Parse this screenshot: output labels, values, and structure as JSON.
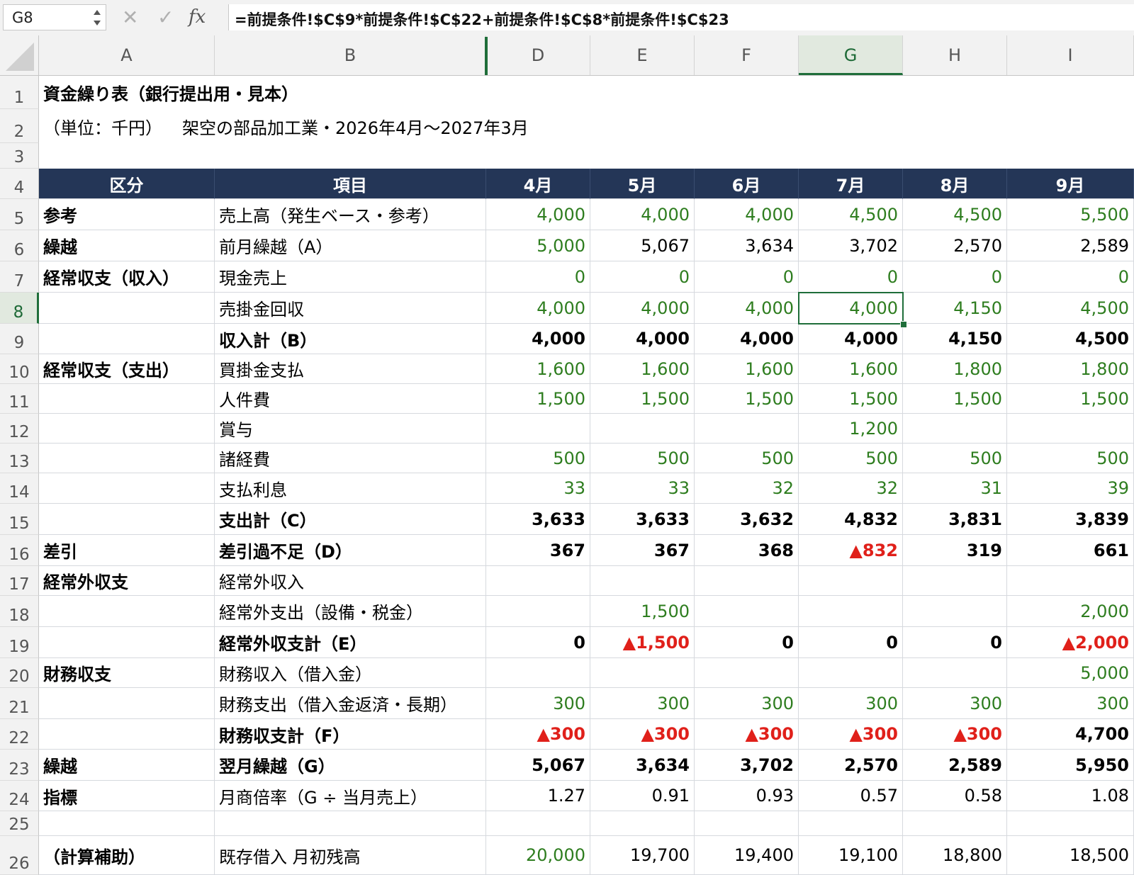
{
  "formula_bar": {
    "name_box": "G8",
    "cancel_icon": "✕",
    "enter_icon": "✓",
    "fx_label": "fx",
    "formula": "=前提条件!$C$9*前提条件!$C$22+前提条件!$C$8*前提条件!$C$23"
  },
  "columns": [
    "A",
    "B",
    "D",
    "E",
    "F",
    "G",
    "H",
    "I"
  ],
  "selected_column": "G",
  "selected_row": "8",
  "rows": [
    "1",
    "2",
    "3",
    "4",
    "5",
    "6",
    "7",
    "8",
    "9",
    "10",
    "11",
    "12",
    "13",
    "14",
    "15",
    "16",
    "17",
    "18",
    "19",
    "20",
    "21",
    "22",
    "23",
    "24",
    "25",
    "26"
  ],
  "sheet": {
    "title": "資金繰り表（銀行提出用・見本）",
    "subtitle_unit": "（単位：千円）",
    "subtitle_company": "架空の部品加工業・2026年4月〜2027年3月",
    "header": [
      "区分",
      "項目",
      "4月",
      "5月",
      "6月",
      "7月",
      "8月",
      "9月"
    ],
    "table": [
      {
        "cat": "参考",
        "item": "売上高（発生ベース・参考）",
        "vals": [
          "4,000",
          "4,000",
          "4,000",
          "4,500",
          "4,500",
          "5,500"
        ],
        "style": "g"
      },
      {
        "cat": "繰越",
        "item": "前月繰越（A）",
        "vals": [
          "5,000",
          "5,067",
          "3,634",
          "3,702",
          "2,570",
          "2,589"
        ],
        "style": "carry"
      },
      {
        "cat": "経常収支（収入）",
        "item": "現金売上",
        "vals": [
          "0",
          "0",
          "0",
          "0",
          "0",
          "0"
        ],
        "style": "g"
      },
      {
        "cat": "",
        "item": "売掛金回収",
        "vals": [
          "4,000",
          "4,000",
          "4,000",
          "4,000",
          "4,150",
          "4,500"
        ],
        "style": "g"
      },
      {
        "cat": "",
        "item": "収入計（B）",
        "vals": [
          "4,000",
          "4,000",
          "4,000",
          "4,000",
          "4,150",
          "4,500"
        ],
        "style": "bold"
      },
      {
        "cat": "経常収支（支出）",
        "item": "買掛金支払",
        "vals": [
          "1,600",
          "1,600",
          "1,600",
          "1,600",
          "1,800",
          "1,800"
        ],
        "style": "g"
      },
      {
        "cat": "",
        "item": "人件費",
        "vals": [
          "1,500",
          "1,500",
          "1,500",
          "1,500",
          "1,500",
          "1,500"
        ],
        "style": "g"
      },
      {
        "cat": "",
        "item": "賞与",
        "vals": [
          "",
          "",
          "",
          "1,200",
          "",
          ""
        ],
        "style": "g"
      },
      {
        "cat": "",
        "item": "諸経費",
        "vals": [
          "500",
          "500",
          "500",
          "500",
          "500",
          "500"
        ],
        "style": "g"
      },
      {
        "cat": "",
        "item": "支払利息",
        "vals": [
          "33",
          "33",
          "32",
          "32",
          "31",
          "39"
        ],
        "style": "g"
      },
      {
        "cat": "",
        "item": "支出計（C）",
        "vals": [
          "3,633",
          "3,633",
          "3,632",
          "4,832",
          "3,831",
          "3,839"
        ],
        "style": "bold"
      },
      {
        "cat": "差引",
        "item": "差引過不足（D）",
        "vals": [
          "367",
          "367",
          "368",
          "▲832",
          "319",
          "661"
        ],
        "style": "bold"
      },
      {
        "cat": "経常外収支",
        "item": "経常外収入",
        "vals": [
          "",
          "",
          "",
          "",
          "",
          ""
        ],
        "style": "g"
      },
      {
        "cat": "",
        "item": "経常外支出（設備・税金）",
        "vals": [
          "",
          "1,500",
          "",
          "",
          "",
          "2,000"
        ],
        "style": "g"
      },
      {
        "cat": "",
        "item": "経常外収支計（E）",
        "vals": [
          "0",
          "▲1,500",
          "0",
          "0",
          "0",
          "▲2,000"
        ],
        "style": "bold"
      },
      {
        "cat": "財務収支",
        "item": "財務収入（借入金）",
        "vals": [
          "",
          "",
          "",
          "",
          "",
          "5,000"
        ],
        "style": "g"
      },
      {
        "cat": "",
        "item": "財務支出（借入金返済・長期）",
        "vals": [
          "300",
          "300",
          "300",
          "300",
          "300",
          "300"
        ],
        "style": "g"
      },
      {
        "cat": "",
        "item": "財務収支計（F）",
        "vals": [
          "▲300",
          "▲300",
          "▲300",
          "▲300",
          "▲300",
          "4,700"
        ],
        "style": "bold"
      },
      {
        "cat": "繰越",
        "item": "翌月繰越（G）",
        "vals": [
          "5,067",
          "3,634",
          "3,702",
          "2,570",
          "2,589",
          "5,950"
        ],
        "style": "bold"
      },
      {
        "cat": "指標",
        "item": "月商倍率（G ÷ 当月売上）",
        "vals": [
          "1.27",
          "0.91",
          "0.93",
          "0.57",
          "0.58",
          "1.08"
        ],
        "style": "plain"
      },
      {
        "cat": "",
        "item": "",
        "vals": [
          "",
          "",
          "",
          "",
          "",
          ""
        ],
        "style": "plain"
      },
      {
        "cat": "（計算補助）",
        "item": "既存借入 月初残高",
        "vals": [
          "20,000",
          "19,700",
          "19,400",
          "19,100",
          "18,800",
          "18,500"
        ],
        "style": "aux"
      }
    ]
  },
  "colors": {
    "header_fill": "#243657",
    "input_green": "#2e7d1f",
    "negative_red": "#e0201a",
    "selection_green": "#1f6e3a"
  }
}
